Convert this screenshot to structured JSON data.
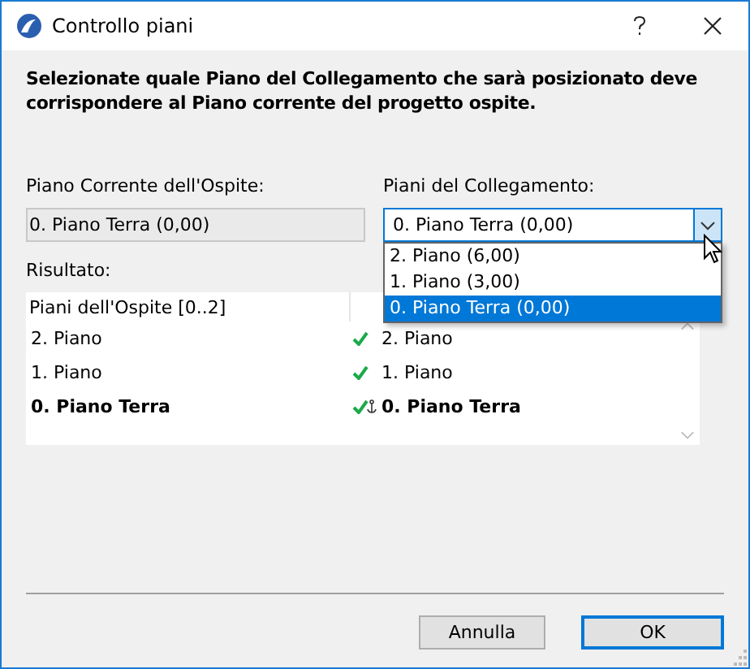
{
  "window": {
    "title": "Controllo piani"
  },
  "instructions": "Selezionate quale Piano del Collegamento che sarà posizionato deve corrispondere al Piano corrente del progetto ospite.",
  "host_story": {
    "label": "Piano Corrente dell'Ospite:",
    "value": "0. Piano Terra (0,00)"
  },
  "link_stories": {
    "label": "Piani del Collegamento:",
    "value": "0. Piano Terra (0,00)",
    "expanded": true,
    "options": [
      {
        "label": "2. Piano (6,00)",
        "selected": false
      },
      {
        "label": "1. Piano (3,00)",
        "selected": false
      },
      {
        "label": "0. Piano Terra (0,00)",
        "selected": true
      }
    ]
  },
  "result": {
    "label": "Risultato:",
    "column_1": "Piani dell'Ospite [0..2]",
    "rows": [
      {
        "host": "2. Piano",
        "link": "2. Piano",
        "matched": true,
        "anchor": false,
        "current": false
      },
      {
        "host": "1. Piano",
        "link": "1. Piano",
        "matched": true,
        "anchor": false,
        "current": false
      },
      {
        "host": "0. Piano Terra",
        "link": "0. Piano Terra",
        "matched": true,
        "anchor": true,
        "current": true
      }
    ]
  },
  "buttons": [
    {
      "label": "Annulla",
      "default": false
    },
    {
      "label": "OK",
      "default": true
    }
  ]
}
